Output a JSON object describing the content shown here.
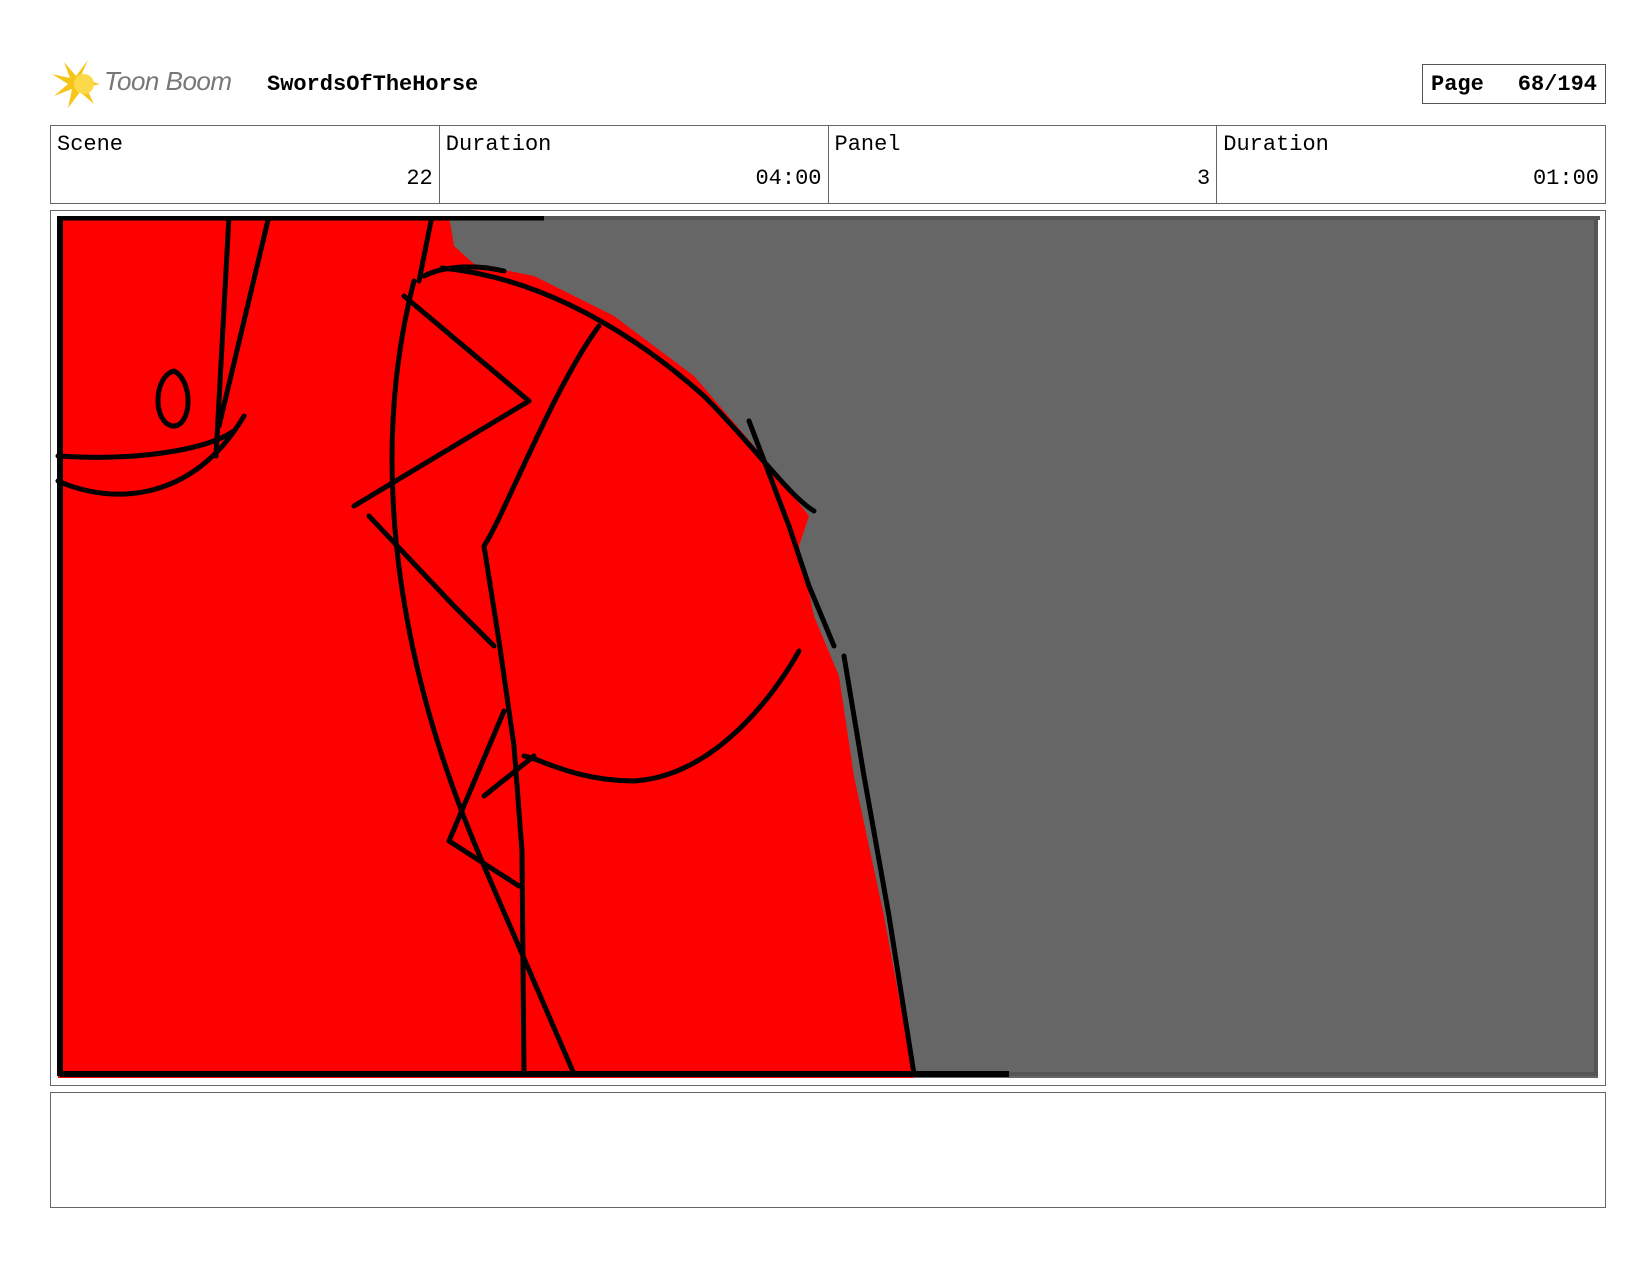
{
  "header": {
    "logo_text": "Toon Boom",
    "project_name": "SwordsOfTheHorse",
    "page_label": "Page",
    "page_value": "68/194"
  },
  "info": {
    "scene_label": "Scene",
    "scene_value": "22",
    "scene_duration_label": "Duration",
    "scene_duration_value": "04:00",
    "panel_label": "Panel",
    "panel_value": "3",
    "panel_duration_label": "Duration",
    "panel_duration_value": "01:00"
  },
  "colors": {
    "figure": "#ff0000",
    "background": "#666666",
    "ink": "#000000",
    "logo_star": "#f5c518"
  },
  "notes": {
    "text": ""
  }
}
